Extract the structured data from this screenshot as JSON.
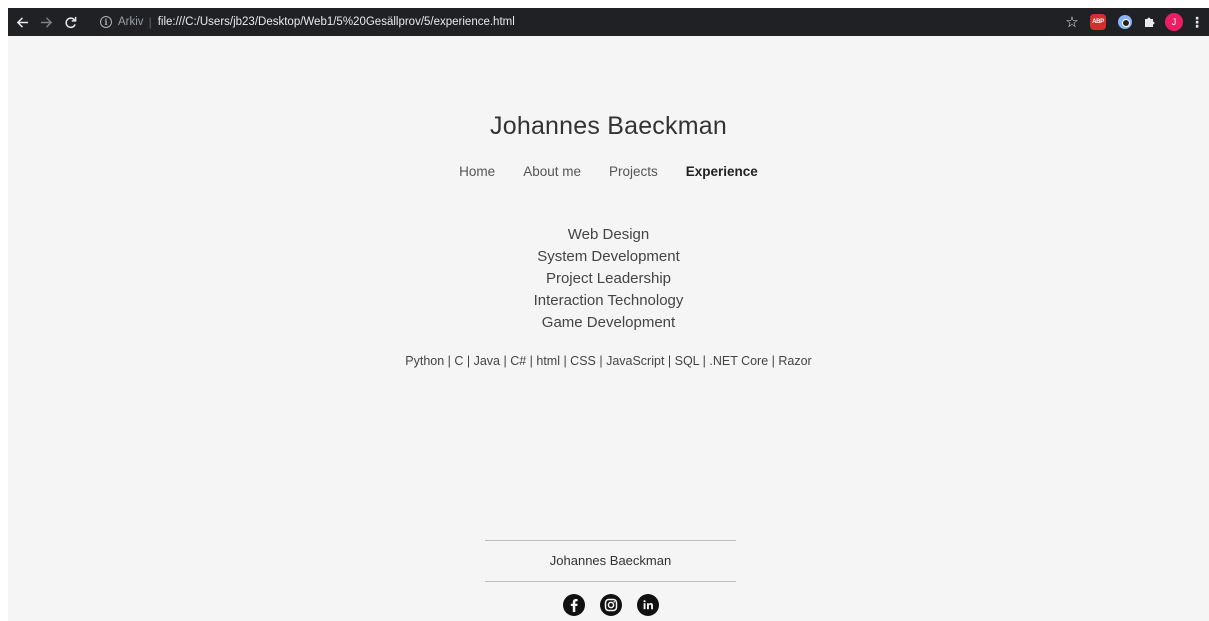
{
  "browser": {
    "scheme_label": "Arkiv",
    "url": "file:///C:/Users/jb23/Desktop/Web1/5%20Gesällprov/5/experience.html",
    "abp_label": "ABP",
    "avatar_initial": "J"
  },
  "site": {
    "title": "Johannes Baeckman",
    "nav": [
      {
        "label": "Home"
      },
      {
        "label": "About me"
      },
      {
        "label": "Projects"
      },
      {
        "label": "Experience"
      }
    ],
    "skills": [
      "Web Design",
      "System Development",
      "Project Leadership",
      "Interaction Technology",
      "Game Development"
    ],
    "languages": "Python | C | Java | C# | html | CSS | JavaScript | SQL | .NET Core | Razor"
  },
  "footer": {
    "name": "Johannes Baeckman",
    "social_icons": [
      "facebook-icon",
      "instagram-icon",
      "linkedin-icon"
    ]
  },
  "colors": {
    "page_background": "#f5f5f5",
    "toolbar_background": "#202124",
    "avatar": "#e91e63",
    "abp": "#d32f2f"
  }
}
